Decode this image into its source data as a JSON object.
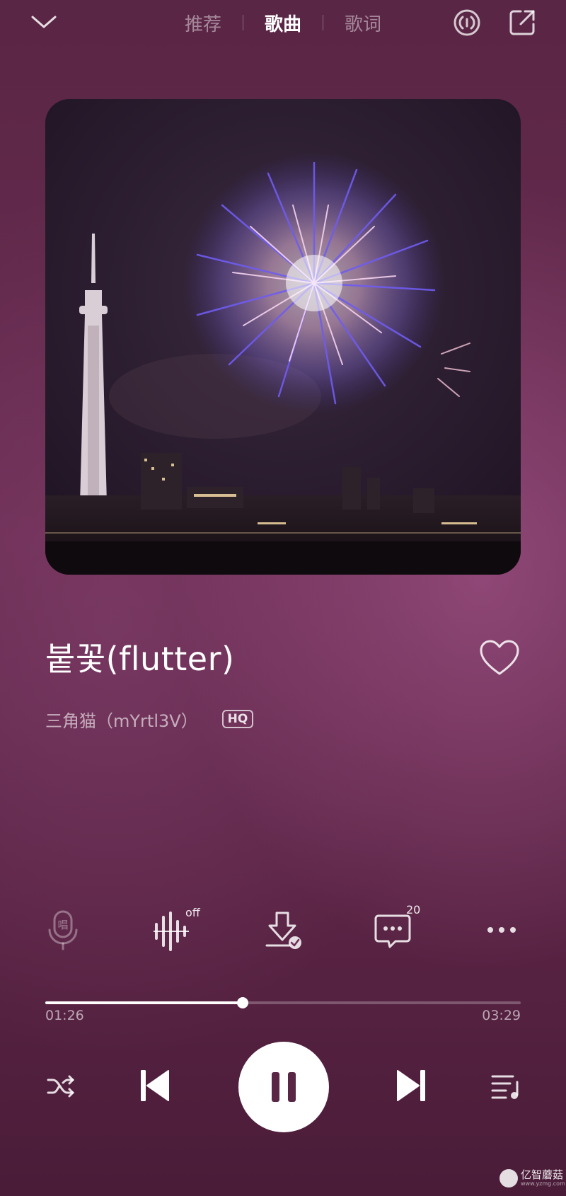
{
  "header": {
    "tabs": [
      {
        "label": "推荐",
        "active": false
      },
      {
        "label": "歌曲",
        "active": true
      },
      {
        "label": "歌词",
        "active": false
      }
    ]
  },
  "song": {
    "title": "붙꽃(flutter)",
    "artist": "三角猫（mYrtl3V）",
    "quality_badge": "HQ",
    "liked": false
  },
  "actions": {
    "karaoke_icon_text": "唱",
    "effect_badge": "off",
    "comment_count": "20"
  },
  "playback": {
    "current_time": "01:26",
    "total_time": "03:29",
    "progress": 0.415,
    "state": "playing"
  },
  "watermark": {
    "text": "亿智蘑菇",
    "sub": "www.yzmg.com"
  },
  "colors": {
    "background": "#6a2c52",
    "accent": "#ffffff"
  }
}
